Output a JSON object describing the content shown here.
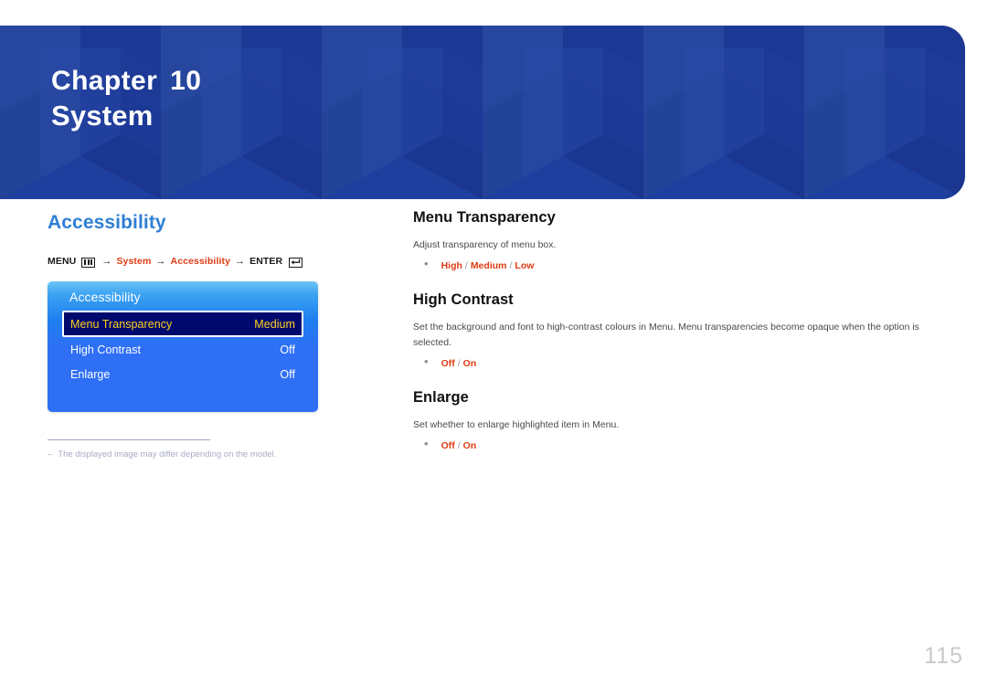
{
  "header": {
    "chapter_label": "Chapter",
    "chapter_number": "10",
    "chapter_title": "System",
    "band_color": "#1f3f9e"
  },
  "left": {
    "section_title": "Accessibility",
    "breadcrumb": {
      "menu_label": "MENU",
      "menu_icon": "menu-grid-icon",
      "arrow": "→",
      "crumb1": "System",
      "crumb2": "Accessibility",
      "enter_label": "ENTER",
      "enter_icon": "enter-return-icon",
      "link_color": "#e03c14"
    },
    "osd": {
      "title": "Accessibility",
      "rows": [
        {
          "label": "Menu Transparency",
          "value": "Medium",
          "selected": true
        },
        {
          "label": "High Contrast",
          "value": "Off",
          "selected": false
        },
        {
          "label": "Enlarge",
          "value": "Off",
          "selected": false
        }
      ],
      "selected_bg": "#000a6e",
      "selected_text": "#ffd21e"
    },
    "footnote": {
      "dash": "–",
      "text": "The displayed image may differ depending on the model."
    }
  },
  "right": {
    "topics": [
      {
        "title": "Menu Transparency",
        "description": "Adjust transparency of menu box.",
        "options": [
          "High",
          "Medium",
          "Low"
        ],
        "separator": "/"
      },
      {
        "title": "High Contrast",
        "description": "Set the background and font to high-contrast colours in Menu. Menu transparencies become opaque when the option is selected.",
        "options": [
          "Off",
          "On"
        ],
        "separator": "/"
      },
      {
        "title": "Enlarge",
        "description": "Set whether to enlarge highlighted item in Menu.",
        "options": [
          "Off",
          "On"
        ],
        "separator": "/"
      }
    ]
  },
  "page_number": "115"
}
